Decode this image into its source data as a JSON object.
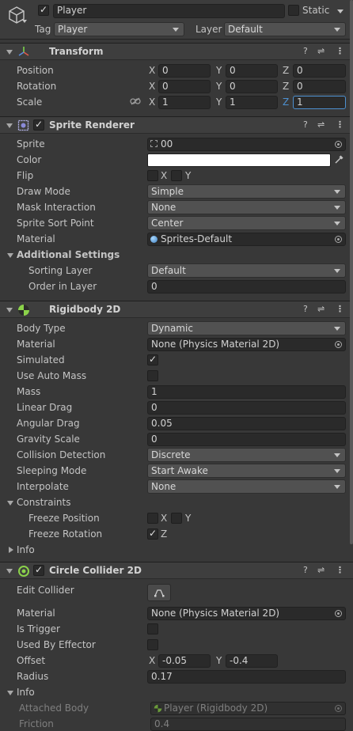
{
  "object": {
    "name": "Player",
    "static_label": "Static",
    "tag_label": "Tag",
    "tag_value": "Player",
    "layer_label": "Layer",
    "layer_value": "Default"
  },
  "transform": {
    "title": "Transform",
    "position_label": "Position",
    "rotation_label": "Rotation",
    "scale_label": "Scale",
    "axis_x": "X",
    "axis_y": "Y",
    "axis_z": "Z",
    "position": [
      "0",
      "0",
      "0"
    ],
    "rotation": [
      "0",
      "0",
      "0"
    ],
    "scale": [
      "1",
      "1",
      "1"
    ]
  },
  "sprite_renderer": {
    "title": "Sprite Renderer",
    "sprite_label": "Sprite",
    "sprite_value": "00",
    "color_label": "Color",
    "flip_label": "Flip",
    "flip_x": "X",
    "flip_y": "Y",
    "draw_mode_label": "Draw Mode",
    "draw_mode_value": "Simple",
    "mask_label": "Mask Interaction",
    "mask_value": "None",
    "sort_point_label": "Sprite Sort Point",
    "sort_point_value": "Center",
    "material_label": "Material",
    "material_value": "Sprites-Default",
    "additional_label": "Additional Settings",
    "sorting_layer_label": "Sorting Layer",
    "sorting_layer_value": "Default",
    "order_label": "Order in Layer",
    "order_value": "0"
  },
  "rigidbody": {
    "title": "Rigidbody 2D",
    "body_type_label": "Body Type",
    "body_type_value": "Dynamic",
    "material_label": "Material",
    "material_value": "None (Physics Material 2D)",
    "simulated_label": "Simulated",
    "auto_mass_label": "Use Auto Mass",
    "mass_label": "Mass",
    "mass_value": "1",
    "linear_drag_label": "Linear Drag",
    "linear_drag_value": "0",
    "angular_drag_label": "Angular Drag",
    "angular_drag_value": "0.05",
    "gravity_label": "Gravity Scale",
    "gravity_value": "0",
    "collision_label": "Collision Detection",
    "collision_value": "Discrete",
    "sleeping_label": "Sleeping Mode",
    "sleeping_value": "Start Awake",
    "interpolate_label": "Interpolate",
    "interpolate_value": "None",
    "constraints_label": "Constraints",
    "freeze_pos_label": "Freeze Position",
    "freeze_rot_label": "Freeze Rotation",
    "x": "X",
    "y": "Y",
    "z": "Z",
    "info_label": "Info"
  },
  "collider": {
    "title": "Circle Collider 2D",
    "edit_label": "Edit Collider",
    "material_label": "Material",
    "material_value": "None (Physics Material 2D)",
    "trigger_label": "Is Trigger",
    "effector_label": "Used By Effector",
    "offset_label": "Offset",
    "offset_x": "-0.05",
    "offset_y": "-0.4",
    "radius_label": "Radius",
    "radius_value": "0.17",
    "info_label": "Info",
    "attached_label": "Attached Body",
    "attached_value": "Player (Rigidbody 2D)",
    "friction_label": "Friction",
    "friction_value": "0.4",
    "x": "X",
    "y": "Y"
  },
  "colors": {
    "background": "#383838",
    "field": "#2a2a2a",
    "accent": "#4d90d0"
  }
}
